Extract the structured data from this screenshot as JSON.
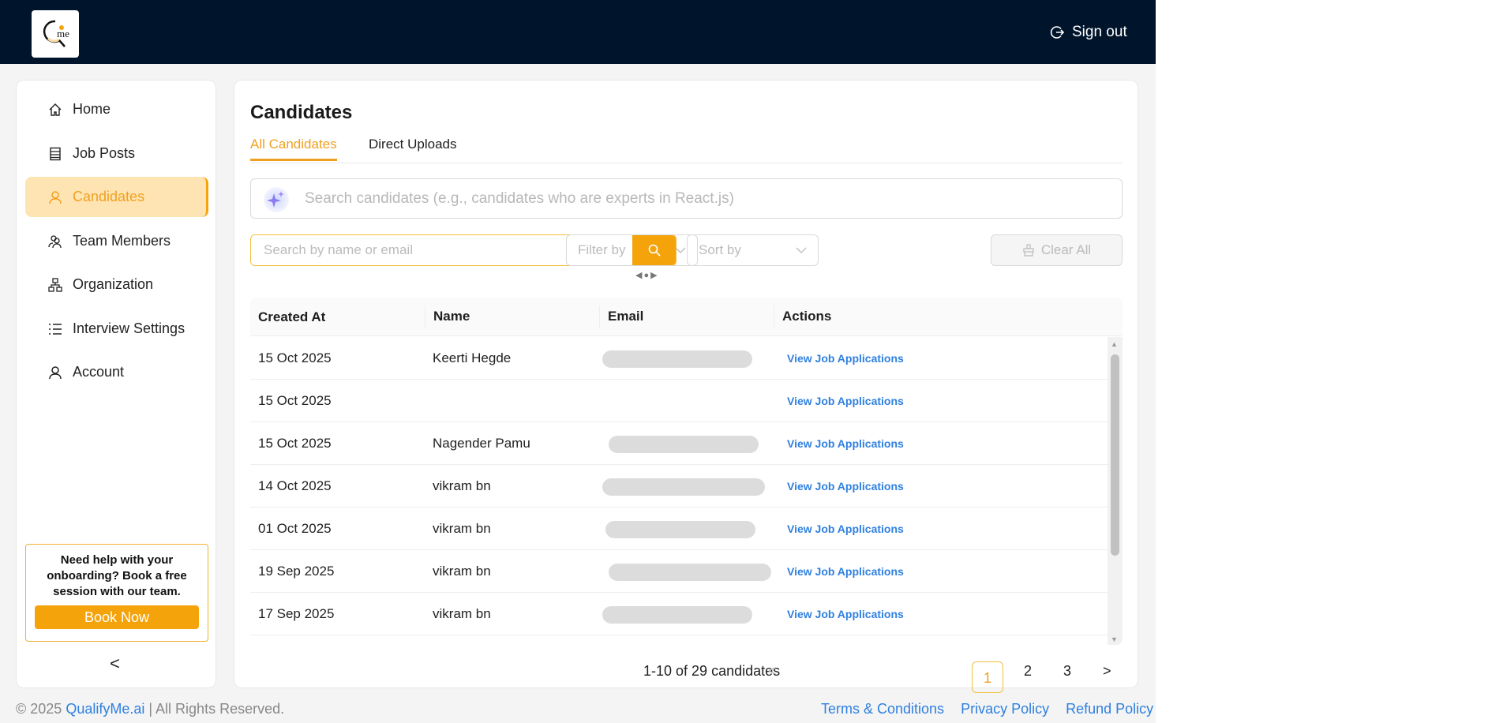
{
  "header": {
    "logo_text": "Qme",
    "sign_out": "Sign out"
  },
  "sidebar": {
    "items": [
      {
        "label": "Home",
        "icon": "home-icon",
        "active": false
      },
      {
        "label": "Job Posts",
        "icon": "document-list-icon",
        "active": false
      },
      {
        "label": "Candidates",
        "icon": "user-icon",
        "active": true
      },
      {
        "label": "Team Members",
        "icon": "team-icon",
        "active": false
      },
      {
        "label": "Organization",
        "icon": "hierarchy-icon",
        "active": false
      },
      {
        "label": "Interview Settings",
        "icon": "list-icon",
        "active": false
      },
      {
        "label": "Account",
        "icon": "user-icon",
        "active": false
      }
    ],
    "help_text": "Need help with your onboarding? Book a free session with our team.",
    "book_now": "Book Now",
    "collapse": "<"
  },
  "main": {
    "title": "Candidates",
    "tabs": [
      {
        "label": "All Candidates",
        "active": true
      },
      {
        "label": "Direct Uploads",
        "active": false
      }
    ],
    "ai_search_placeholder": "Search candidates (e.g., candidates who are experts in React.js)",
    "search_placeholder": "Search by name or email",
    "filter_placeholder": "Filter by",
    "sort_placeholder": "Sort by",
    "clear_all": "Clear All",
    "columns": [
      "Created At",
      "Name",
      "Email",
      "Actions"
    ],
    "rows": [
      {
        "created": "15 Oct 2025",
        "name": "Keerti Hegde",
        "email_redacted": true,
        "action": "View Job Applications"
      },
      {
        "created": "15 Oct 2025",
        "name": "",
        "email_redacted": false,
        "action": "View Job Applications"
      },
      {
        "created": "15 Oct 2025",
        "name": "Nagender Pamu",
        "email_redacted": true,
        "action": "View Job Applications"
      },
      {
        "created": "14 Oct 2025",
        "name": "vikram bn",
        "email_redacted": true,
        "action": "View Job Applications"
      },
      {
        "created": "01 Oct 2025",
        "name": "vikram bn",
        "email_redacted": true,
        "action": "View Job Applications"
      },
      {
        "created": "19 Sep 2025",
        "name": "vikram bn",
        "email_redacted": true,
        "action": "View Job Applications"
      },
      {
        "created": "17 Sep 2025",
        "name": "vikram bn",
        "email_redacted": true,
        "action": "View Job Applications"
      }
    ],
    "pagination": {
      "summary": "1-10 of 29 candidates",
      "pages": [
        "1",
        "2",
        "3"
      ],
      "current": "1",
      "prev": "<",
      "next": ">"
    }
  },
  "footer": {
    "copyright_prefix": "© 2025 ",
    "brand": "QualifyMe.ai",
    "copyright_suffix": " | All Rights Reserved.",
    "links": [
      "Terms & Conditions",
      "Privacy Policy",
      "Refund Policy"
    ]
  },
  "colors": {
    "header": "#00152b",
    "accent": "#f5a30a",
    "link": "#2f80e0"
  }
}
